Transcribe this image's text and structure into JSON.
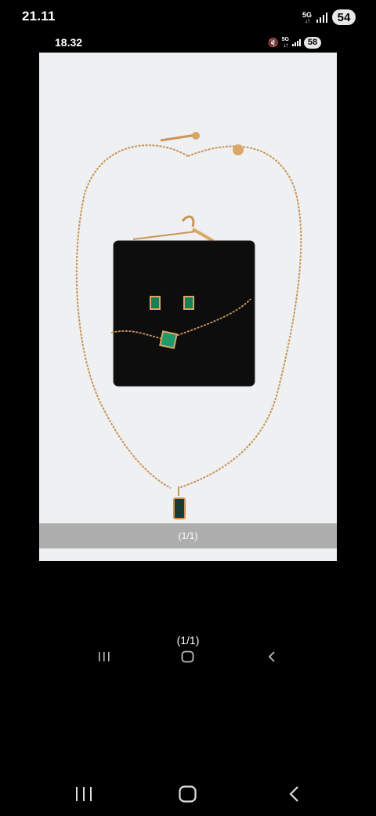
{
  "status_bar": {
    "time": "21.11",
    "network": "5G",
    "battery": "54"
  },
  "inner_status_bar": {
    "time": "18.32",
    "network": "5G",
    "battery": "58"
  },
  "viewer": {
    "counter_overlay": "(1/1)",
    "caption": "(1/1)"
  },
  "colors": {
    "background": "#000000",
    "photo_background": "#eff0f2",
    "gold_chain": "#c9955a",
    "emerald": "#1f9a6a",
    "velvet_box": "#0d0d0d"
  },
  "icons": {
    "recent_apps": "recent-apps-icon",
    "home": "home-icon",
    "back": "back-icon",
    "signal": "signal-icon",
    "mute": "mute-icon"
  }
}
